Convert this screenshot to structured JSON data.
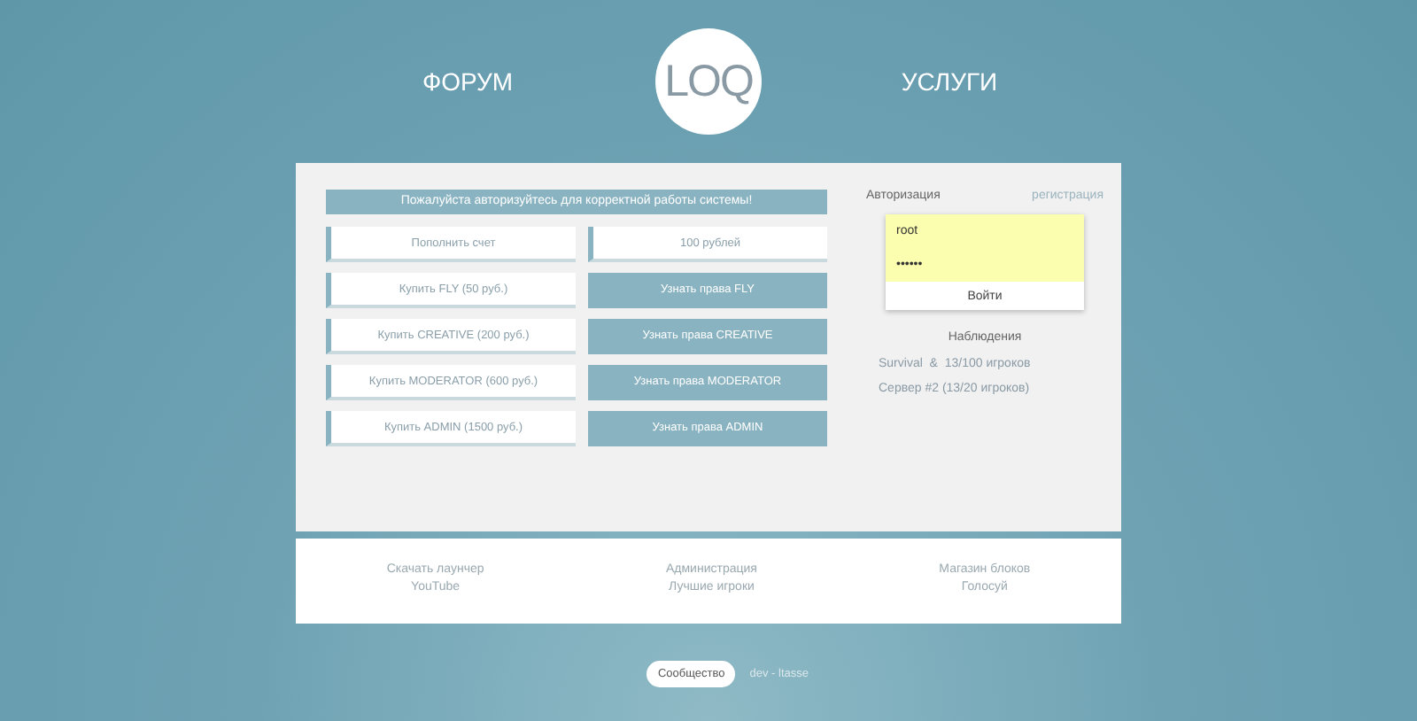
{
  "nav": {
    "left": "ФОРУМ",
    "logo": "LOQ",
    "right": "УСЛУГИ"
  },
  "notice": "Пожалуйста авторизуйтесь для корректной работы системы!",
  "actions": [
    {
      "kind": "outline",
      "label": "Пополнить счет"
    },
    {
      "kind": "outline",
      "label": "100 рублей"
    },
    {
      "kind": "outline",
      "label": "Купить FLY (50 руб.)"
    },
    {
      "kind": "filled",
      "label": "Узнать права FLY"
    },
    {
      "kind": "outline",
      "label": "Купить CREATIVE (200  руб.)"
    },
    {
      "kind": "filled",
      "label": "Узнать права CREATIVE"
    },
    {
      "kind": "outline",
      "label": "Купить MODERATOR (600  руб.)"
    },
    {
      "kind": "filled",
      "label": "Узнать права MODERATOR"
    },
    {
      "kind": "outline",
      "label": "Купить ADMIN (1500  руб.)"
    },
    {
      "kind": "filled",
      "label": "Узнать права ADMIN"
    }
  ],
  "auth": {
    "title": "Авторизация",
    "register": "регистрация",
    "login": "root",
    "password": "••••••",
    "submit": "Войти"
  },
  "monitoring": {
    "title": "Наблюдения",
    "servers": [
      "Survival  &  13/100 игроков",
      "Сервер #2 (13/20 игроков)"
    ]
  },
  "footer_links": [
    [
      "Скачать лаунчер",
      "YouTube"
    ],
    [
      "Администрация",
      "Лучшие игроки"
    ],
    [
      "Магазин блоков",
      "Голосуй"
    ]
  ],
  "bottom": {
    "community": "Сообщество",
    "credit": "dev - ltasse"
  }
}
